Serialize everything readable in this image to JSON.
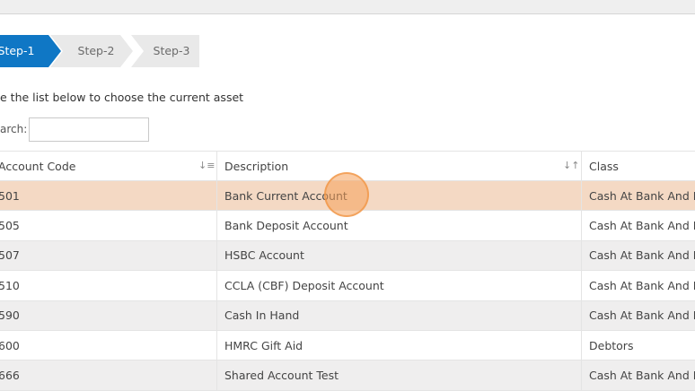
{
  "wizard": {
    "steps": [
      {
        "label": "Step-1",
        "active": true
      },
      {
        "label": "Step-2",
        "active": false
      },
      {
        "label": "Step-3",
        "active": false
      }
    ],
    "instruction": "e the list below to choose the current asset"
  },
  "search": {
    "label": "arch:",
    "value": "",
    "placeholder": ""
  },
  "table": {
    "columns": [
      {
        "label": "Account Code",
        "sort_icon": "sort-ascending-icon"
      },
      {
        "label": "Description",
        "sort_icon": "sort-icon"
      },
      {
        "label": "Class"
      }
    ],
    "rows": [
      {
        "code": "501",
        "description": "Bank Current Account",
        "class": "Cash At Bank And In I",
        "selected": true
      },
      {
        "code": "505",
        "description": "Bank Deposit Account",
        "class": "Cash At Bank And In I"
      },
      {
        "code": "507",
        "description": "HSBC Account",
        "class": "Cash At Bank And In I"
      },
      {
        "code": "510",
        "description": "CCLA (CBF) Deposit Account",
        "class": "Cash At Bank And In I"
      },
      {
        "code": "590",
        "description": "Cash In Hand",
        "class": "Cash At Bank And In I"
      },
      {
        "code": "600",
        "description": "HMRC Gift Aid",
        "class": "Debtors"
      },
      {
        "code": "666",
        "description": "Shared Account Test",
        "class": "Cash At Bank And In I"
      }
    ]
  },
  "colors": {
    "accent": "#0f77c5",
    "selected_row": "#f4d9c4",
    "alt_row": "#efeeee",
    "click_indicator": "#f5a05a"
  }
}
